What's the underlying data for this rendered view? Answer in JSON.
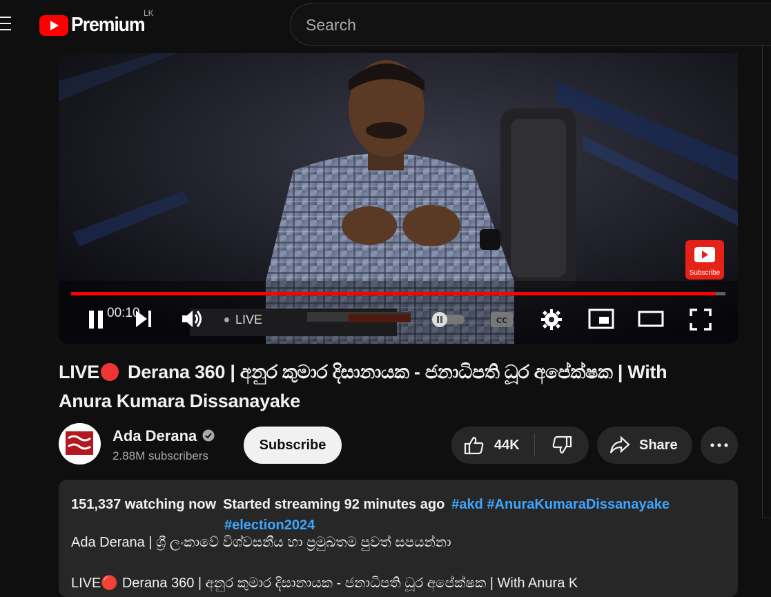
{
  "header": {
    "logo_text": "Premium",
    "country_code": "LK",
    "search_placeholder": "Search"
  },
  "player": {
    "time": "00:10",
    "live_label": "LIVE",
    "progress_fraction": 0.985,
    "watermark_text": "Subscribe"
  },
  "video": {
    "title_prefix": "LIVE",
    "title_main": "Derana 360 | අනුර කුමාර දිසානායක - ජනාධිපති ධූර අපේක්ෂක | With Anura Kumara Dissanayake"
  },
  "channel": {
    "name": "Ada Derana",
    "subscribers": "2.88M subscribers",
    "subscribe_label": "Subscribe",
    "like_count": "44K",
    "share_label": "Share"
  },
  "description": {
    "watching": "151,337 watching now",
    "started": "Started streaming 92 minutes ago",
    "hashtag1": "#akd",
    "hashtag2": "#AnuraKumaraDissanayake",
    "hashtag3": "#election2024",
    "line1": "Ada Derana | ශ්‍රී ලංකාවේ විශ්වසනීය හා ප්‍රමුඛතම පුවත් සපයන්නා",
    "line2": "LIVE🔴 Derana 360 | අනුර කුමාර දිසානායක - ජනාධිපති ධූර අපේක්ෂක | With Anura K"
  },
  "colors": {
    "accent_red": "#ff0000",
    "link_blue": "#3ea6ff",
    "background": "#0f0f0f"
  }
}
